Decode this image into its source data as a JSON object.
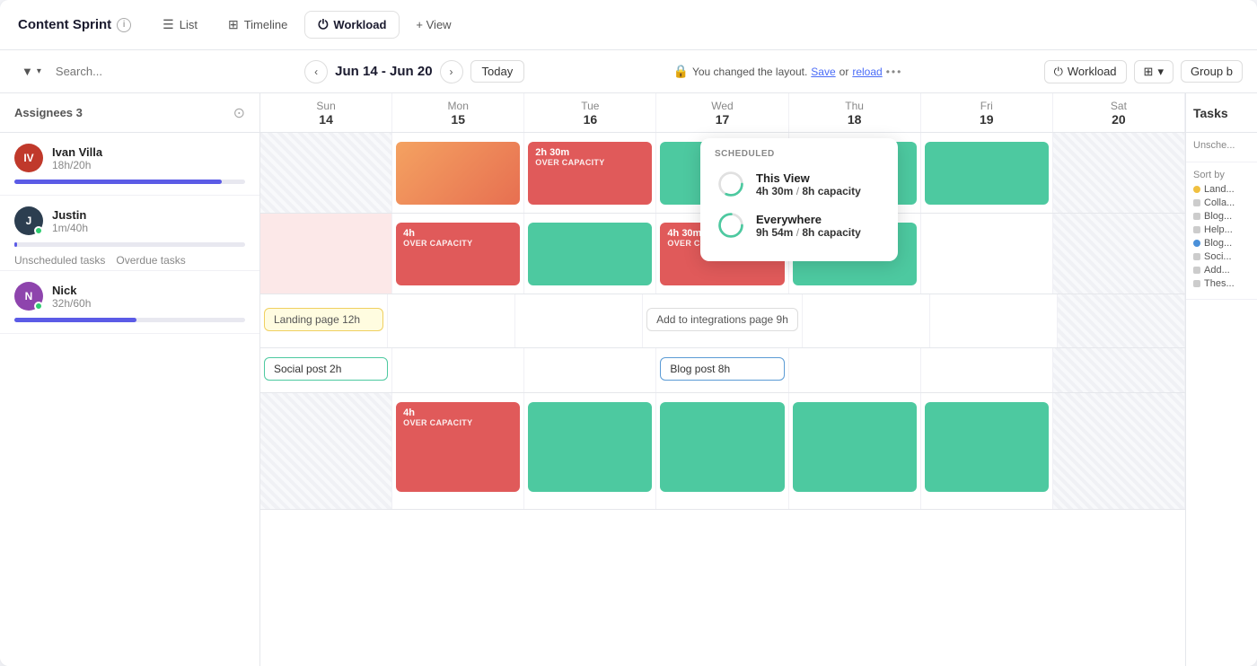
{
  "header": {
    "project_title": "Content Sprint",
    "tabs": [
      {
        "id": "list",
        "label": "List",
        "icon": "≡",
        "active": false
      },
      {
        "id": "timeline",
        "label": "Timeline",
        "icon": "▦",
        "active": false
      },
      {
        "id": "workload",
        "label": "Workload",
        "icon": "⏻",
        "active": true
      }
    ],
    "add_view_label": "+ View"
  },
  "toolbar": {
    "filter_icon": "▼",
    "search_placeholder": "Search...",
    "date_range": "Jun 14 - Jun 20",
    "today_label": "Today",
    "banner_text": "You changed the layout.",
    "banner_save": "Save",
    "banner_reload": "reload",
    "banner_dots": "•••",
    "workload_label": "Workload",
    "group_by_label": "Group b"
  },
  "assignees_panel": {
    "title": "Assignees 3",
    "assignees": [
      {
        "id": "ivan",
        "name": "Ivan Villa",
        "hours": "18h/20h",
        "progress": 90,
        "avatar_bg": "#c0392b",
        "initials": "IV",
        "has_status": false
      },
      {
        "id": "justin",
        "name": "Justin",
        "hours": "1m/40h",
        "progress": 1,
        "avatar_bg": "#2c3e50",
        "initials": "J",
        "has_status": true,
        "status_color": "#2ecc71"
      },
      {
        "id": "nick",
        "name": "Nick",
        "hours": "32h/60h",
        "progress": 53,
        "avatar_bg": "#8e44ad",
        "initials": "N",
        "has_status": true,
        "status_color": "#2ecc71"
      }
    ],
    "unscheduled_label": "Unscheduled tasks",
    "overdue_label": "Overdue tasks"
  },
  "calendar": {
    "days": [
      {
        "label": "Sun",
        "num": "14",
        "is_weekend": true,
        "is_today": false
      },
      {
        "label": "Mon",
        "num": "15",
        "is_weekend": false,
        "is_today": false
      },
      {
        "label": "Tue",
        "num": "16",
        "is_weekend": false,
        "is_today": false
      },
      {
        "label": "Wed",
        "num": "17",
        "is_weekend": false,
        "is_today": false
      },
      {
        "label": "Thu",
        "num": "18",
        "is_weekend": false,
        "is_today": false
      },
      {
        "label": "Fri",
        "num": "19",
        "is_weekend": false,
        "is_today": false
      },
      {
        "label": "Sat",
        "num": "20",
        "is_weekend": true,
        "is_today": false
      }
    ],
    "ivan_blocks": [
      "weekend",
      "orange",
      "red_2h30",
      "green_large",
      "green",
      "green",
      "weekend"
    ],
    "justin_blocks": [
      "pink_weekend",
      "red_4h",
      "light_green",
      "red_4h30",
      "green_large",
      "empty",
      "weekend"
    ],
    "nick_blocks": [
      "weekend",
      "red_4h",
      "light_green",
      "green",
      "green",
      "green",
      "weekend"
    ]
  },
  "tooltip": {
    "header": "SCHEDULED",
    "rows": [
      {
        "label": "This View",
        "hours": "4h 30m",
        "capacity": "8h capacity",
        "progress": 56
      },
      {
        "label": "Everywhere",
        "hours": "9h 54m",
        "capacity": "8h capacity",
        "progress": 100
      }
    ]
  },
  "tasks": [
    {
      "id": "landing",
      "label": "Landing page 12h",
      "type": "yellow",
      "span_start": 1,
      "span_end": 3
    },
    {
      "id": "social",
      "label": "Social post 2h",
      "type": "green-outline",
      "span_start": 1,
      "span_end": 2
    },
    {
      "id": "integrations",
      "label": "Add to integrations page 9h",
      "type": "no-border",
      "span_start": 3,
      "span_end": 5
    },
    {
      "id": "blog",
      "label": "Blog post 8h",
      "type": "blue-outline",
      "span_start": 3,
      "span_end": 4
    }
  ],
  "tasks_panel": {
    "title": "Tasks",
    "unscheduled_label": "Unsche...",
    "sort_by_label": "Sort by",
    "tags": [
      {
        "label": "Land...",
        "color": "#f0c040",
        "shape": "circle"
      },
      {
        "label": "Colla...",
        "color": "#ccc",
        "shape": "square"
      },
      {
        "label": "Blog...",
        "color": "#ccc",
        "shape": "square"
      },
      {
        "label": "Help...",
        "color": "#ccc",
        "shape": "square"
      },
      {
        "label": "Blog...",
        "color": "#4a90d9",
        "shape": "circle"
      },
      {
        "label": "Soci...",
        "color": "#ccc",
        "shape": "square"
      },
      {
        "label": "Add...",
        "color": "#ccc",
        "shape": "square"
      },
      {
        "label": "Thes...",
        "color": "#ccc",
        "shape": "square"
      }
    ]
  }
}
